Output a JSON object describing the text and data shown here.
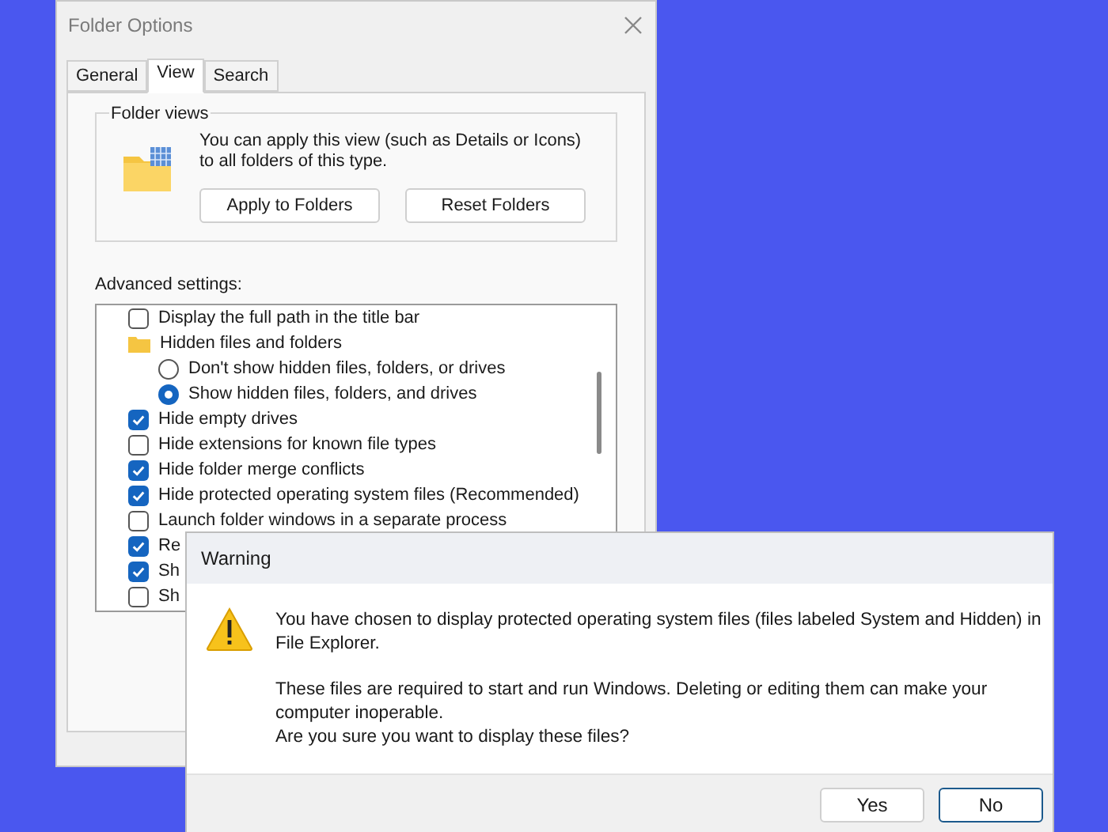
{
  "folder_options": {
    "title": "Folder Options",
    "tabs": [
      {
        "label": "General",
        "selected": false
      },
      {
        "label": "View",
        "selected": true
      },
      {
        "label": "Search",
        "selected": false
      }
    ],
    "folder_views": {
      "legend": "Folder views",
      "text": "You can apply this view (such as Details or Icons) to all folders of this type.",
      "buttons": [
        "Apply to Folders",
        "Reset Folders"
      ]
    },
    "advanced_label": "Advanced settings:",
    "settings": [
      {
        "kind": "checkbox",
        "label": "Display the full path in the title bar",
        "checked": false
      },
      {
        "kind": "folder",
        "label": "Hidden files and folders"
      },
      {
        "kind": "radio",
        "label": "Don't show hidden files, folders, or drives",
        "selected": false
      },
      {
        "kind": "radio",
        "label": "Show hidden files, folders, and drives",
        "selected": true
      },
      {
        "kind": "checkbox",
        "label": "Hide empty drives",
        "checked": true
      },
      {
        "kind": "checkbox",
        "label": "Hide extensions for known file types",
        "checked": false
      },
      {
        "kind": "checkbox",
        "label": "Hide folder merge conflicts",
        "checked": true
      },
      {
        "kind": "checkbox",
        "label": "Hide protected operating system files (Recommended)",
        "checked": true
      },
      {
        "kind": "checkbox",
        "label": "Launch folder windows in a separate process",
        "checked": false
      },
      {
        "kind": "checkbox",
        "label": "Re",
        "checked": true
      },
      {
        "kind": "checkbox",
        "label": "Sh",
        "checked": true
      },
      {
        "kind": "checkbox",
        "label": "Sh",
        "checked": false
      }
    ]
  },
  "warning": {
    "title": "Warning",
    "message": "You have chosen to display protected operating system files (files labeled System and Hidden) in File Explorer.",
    "detail": "These files are required to start and run Windows. Deleting or editing them can make your computer inoperable.",
    "question": "Are you sure you want to display these files?",
    "buttons": [
      {
        "label": "Yes",
        "selected": false
      },
      {
        "label": "No",
        "selected": true
      }
    ]
  }
}
